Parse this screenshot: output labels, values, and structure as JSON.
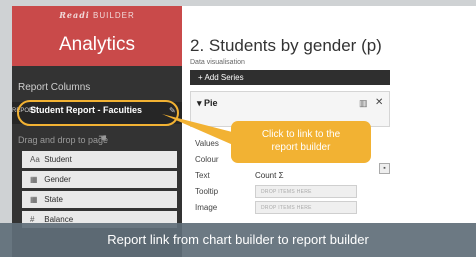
{
  "sidebar": {
    "brand_strong": "Readi",
    "brand_rest": " BUILDER",
    "app_title": "Analytics",
    "report_columns_label": "Report Columns",
    "report_prefix": "REPORT",
    "report_name": "Student Report - Faculties",
    "drag_drop_label": "Drag and drop to page",
    "fields": [
      {
        "label": "Student",
        "icon": "text-field-icon"
      },
      {
        "label": "Gender",
        "icon": "category-icon"
      },
      {
        "label": "State",
        "icon": "category-icon"
      },
      {
        "label": "Balance",
        "icon": "number-icon"
      }
    ]
  },
  "main": {
    "title": "2. Students by gender (p)",
    "subtitle": "Data visualisation",
    "add_series_label": "+ Add Series",
    "series_name": "Pie",
    "properties": [
      {
        "label": "Values",
        "value": ""
      },
      {
        "label": "Colour",
        "value": ""
      },
      {
        "label": "Text",
        "value": "Count Σ"
      },
      {
        "label": "Tooltip",
        "value": "DROP ITEMS HERE"
      },
      {
        "label": "Image",
        "value": "DROP ITEMS HERE"
      }
    ]
  },
  "callout": {
    "line1": "Click to link to the",
    "line2": "report builder"
  },
  "caption": "Report link from chart builder to report builder",
  "colors": {
    "brand_red": "#c94a4a",
    "sidebar_bg": "#333333",
    "accent_orange": "#f2b233",
    "caption_bg": "#606e78"
  }
}
